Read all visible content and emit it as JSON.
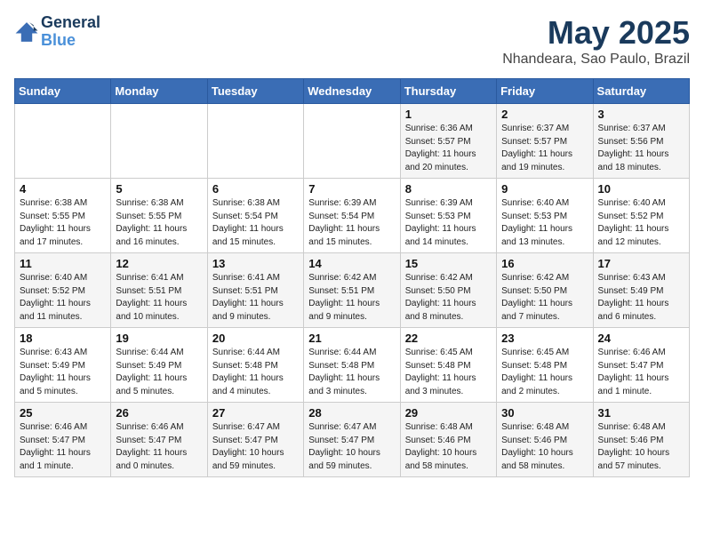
{
  "logo": {
    "text_general": "General",
    "text_blue": "Blue"
  },
  "header": {
    "title": "May 2025",
    "subtitle": "Nhandeara, Sao Paulo, Brazil"
  },
  "days_of_week": [
    "Sunday",
    "Monday",
    "Tuesday",
    "Wednesday",
    "Thursday",
    "Friday",
    "Saturday"
  ],
  "weeks": [
    [
      {
        "day": "",
        "info": ""
      },
      {
        "day": "",
        "info": ""
      },
      {
        "day": "",
        "info": ""
      },
      {
        "day": "",
        "info": ""
      },
      {
        "day": "1",
        "info": "Sunrise: 6:36 AM\nSunset: 5:57 PM\nDaylight: 11 hours\nand 20 minutes."
      },
      {
        "day": "2",
        "info": "Sunrise: 6:37 AM\nSunset: 5:57 PM\nDaylight: 11 hours\nand 19 minutes."
      },
      {
        "day": "3",
        "info": "Sunrise: 6:37 AM\nSunset: 5:56 PM\nDaylight: 11 hours\nand 18 minutes."
      }
    ],
    [
      {
        "day": "4",
        "info": "Sunrise: 6:38 AM\nSunset: 5:55 PM\nDaylight: 11 hours\nand 17 minutes."
      },
      {
        "day": "5",
        "info": "Sunrise: 6:38 AM\nSunset: 5:55 PM\nDaylight: 11 hours\nand 16 minutes."
      },
      {
        "day": "6",
        "info": "Sunrise: 6:38 AM\nSunset: 5:54 PM\nDaylight: 11 hours\nand 15 minutes."
      },
      {
        "day": "7",
        "info": "Sunrise: 6:39 AM\nSunset: 5:54 PM\nDaylight: 11 hours\nand 15 minutes."
      },
      {
        "day": "8",
        "info": "Sunrise: 6:39 AM\nSunset: 5:53 PM\nDaylight: 11 hours\nand 14 minutes."
      },
      {
        "day": "9",
        "info": "Sunrise: 6:40 AM\nSunset: 5:53 PM\nDaylight: 11 hours\nand 13 minutes."
      },
      {
        "day": "10",
        "info": "Sunrise: 6:40 AM\nSunset: 5:52 PM\nDaylight: 11 hours\nand 12 minutes."
      }
    ],
    [
      {
        "day": "11",
        "info": "Sunrise: 6:40 AM\nSunset: 5:52 PM\nDaylight: 11 hours\nand 11 minutes."
      },
      {
        "day": "12",
        "info": "Sunrise: 6:41 AM\nSunset: 5:51 PM\nDaylight: 11 hours\nand 10 minutes."
      },
      {
        "day": "13",
        "info": "Sunrise: 6:41 AM\nSunset: 5:51 PM\nDaylight: 11 hours\nand 9 minutes."
      },
      {
        "day": "14",
        "info": "Sunrise: 6:42 AM\nSunset: 5:51 PM\nDaylight: 11 hours\nand 9 minutes."
      },
      {
        "day": "15",
        "info": "Sunrise: 6:42 AM\nSunset: 5:50 PM\nDaylight: 11 hours\nand 8 minutes."
      },
      {
        "day": "16",
        "info": "Sunrise: 6:42 AM\nSunset: 5:50 PM\nDaylight: 11 hours\nand 7 minutes."
      },
      {
        "day": "17",
        "info": "Sunrise: 6:43 AM\nSunset: 5:49 PM\nDaylight: 11 hours\nand 6 minutes."
      }
    ],
    [
      {
        "day": "18",
        "info": "Sunrise: 6:43 AM\nSunset: 5:49 PM\nDaylight: 11 hours\nand 5 minutes."
      },
      {
        "day": "19",
        "info": "Sunrise: 6:44 AM\nSunset: 5:49 PM\nDaylight: 11 hours\nand 5 minutes."
      },
      {
        "day": "20",
        "info": "Sunrise: 6:44 AM\nSunset: 5:48 PM\nDaylight: 11 hours\nand 4 minutes."
      },
      {
        "day": "21",
        "info": "Sunrise: 6:44 AM\nSunset: 5:48 PM\nDaylight: 11 hours\nand 3 minutes."
      },
      {
        "day": "22",
        "info": "Sunrise: 6:45 AM\nSunset: 5:48 PM\nDaylight: 11 hours\nand 3 minutes."
      },
      {
        "day": "23",
        "info": "Sunrise: 6:45 AM\nSunset: 5:48 PM\nDaylight: 11 hours\nand 2 minutes."
      },
      {
        "day": "24",
        "info": "Sunrise: 6:46 AM\nSunset: 5:47 PM\nDaylight: 11 hours\nand 1 minute."
      }
    ],
    [
      {
        "day": "25",
        "info": "Sunrise: 6:46 AM\nSunset: 5:47 PM\nDaylight: 11 hours\nand 1 minute."
      },
      {
        "day": "26",
        "info": "Sunrise: 6:46 AM\nSunset: 5:47 PM\nDaylight: 11 hours\nand 0 minutes."
      },
      {
        "day": "27",
        "info": "Sunrise: 6:47 AM\nSunset: 5:47 PM\nDaylight: 10 hours\nand 59 minutes."
      },
      {
        "day": "28",
        "info": "Sunrise: 6:47 AM\nSunset: 5:47 PM\nDaylight: 10 hours\nand 59 minutes."
      },
      {
        "day": "29",
        "info": "Sunrise: 6:48 AM\nSunset: 5:46 PM\nDaylight: 10 hours\nand 58 minutes."
      },
      {
        "day": "30",
        "info": "Sunrise: 6:48 AM\nSunset: 5:46 PM\nDaylight: 10 hours\nand 58 minutes."
      },
      {
        "day": "31",
        "info": "Sunrise: 6:48 AM\nSunset: 5:46 PM\nDaylight: 10 hours\nand 57 minutes."
      }
    ]
  ]
}
